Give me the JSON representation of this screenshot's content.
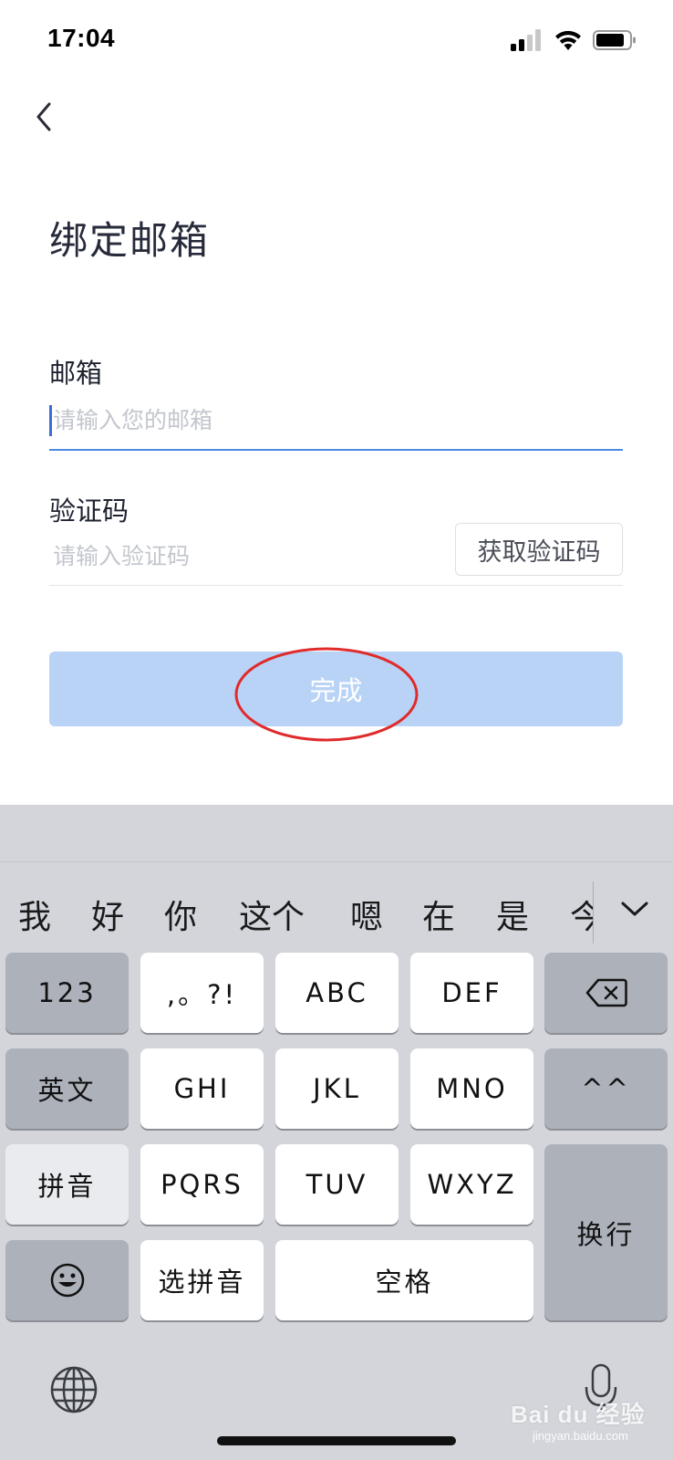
{
  "status_bar": {
    "time": "17:04",
    "icons": [
      "cellular-signal-icon",
      "wifi-icon",
      "battery-icon"
    ]
  },
  "nav": {
    "back_icon": "chevron-left-icon"
  },
  "page": {
    "title": "绑定邮箱"
  },
  "form": {
    "email": {
      "label": "邮箱",
      "value": "",
      "placeholder": "请输入您的邮箱"
    },
    "code": {
      "label": "验证码",
      "value": "",
      "placeholder": "请输入验证码",
      "get_code_label": "获取验证码"
    },
    "submit_label": "完成"
  },
  "annotation": {
    "color": "#e02b2b",
    "shape": "ellipse around submit button"
  },
  "keyboard": {
    "candidates": [
      "我",
      "好",
      "你",
      "这个",
      "嗯",
      "在",
      "是",
      "今"
    ],
    "expand_icon": "chevron-down-icon",
    "rows": [
      [
        "123",
        ",。?!",
        "ABC",
        "DEF",
        "delete"
      ],
      [
        "英文",
        "GHI",
        "JKL",
        "MNO",
        "^^"
      ],
      [
        "拼音",
        "PQRS",
        "TUV",
        "WXYZ",
        "换行"
      ],
      [
        "emoji",
        "选拼音",
        "空格"
      ]
    ],
    "keys": {
      "num": "123",
      "punct": ",。?!",
      "abc": "ABC",
      "def": "DEF",
      "english": "英文",
      "ghi": "GHI",
      "jkl": "JKL",
      "mno": "MNO",
      "kaomoji": "^^",
      "pinyin": "拼音",
      "pqrs": "PQRS",
      "tuv": "TUV",
      "wxyz": "WXYZ",
      "newline": "换行",
      "select_pinyin": "选拼音",
      "space": "空格"
    },
    "bottom_icons": [
      "globe-icon",
      "microphone-icon"
    ]
  },
  "watermark": {
    "text": "Bai du 经验",
    "sub": "jingyan.baidu.com"
  },
  "colors": {
    "accent": "#4a8be0",
    "submit_bg": "#b9d3f6",
    "keyboard_bg": "#d3d5db",
    "dark_key": "#adb1ba"
  }
}
